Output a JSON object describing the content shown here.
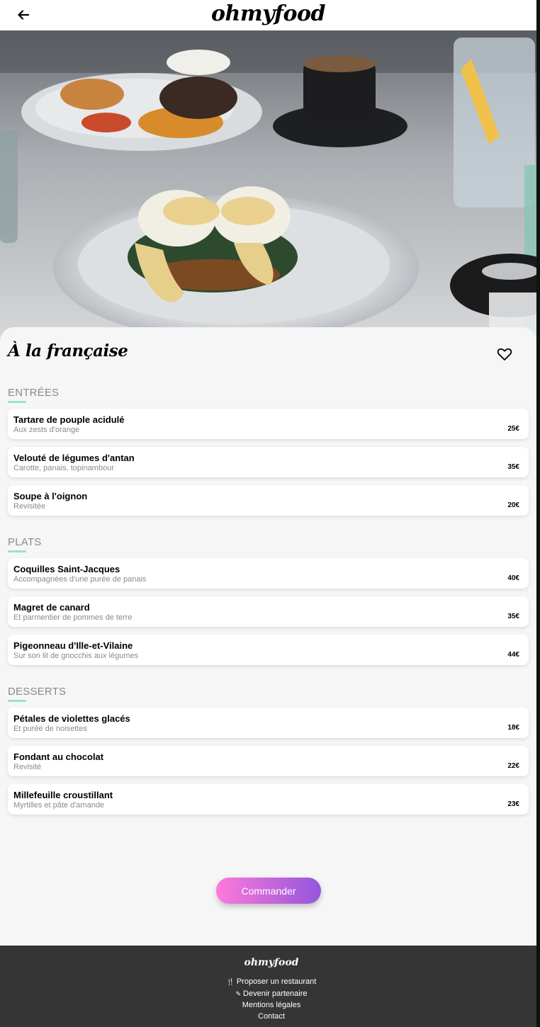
{
  "header": {
    "logo": "ohmyfood",
    "back_icon": "arrow-left-icon"
  },
  "restaurant": {
    "title": "À la française",
    "favorite_icon": "heart-outline-icon"
  },
  "menu": [
    {
      "section": "ENTRÉES",
      "dishes": [
        {
          "name": "Tartare de pouple acidulé",
          "desc": "Aux zests d'orange",
          "price": "25€"
        },
        {
          "name": "Velouté de légumes d'antan",
          "desc": "Carotte, panais, topinambour",
          "price": "35€"
        },
        {
          "name": "Soupe à l'oignon",
          "desc": "Revisitée",
          "price": "20€"
        }
      ]
    },
    {
      "section": "PLATS",
      "dishes": [
        {
          "name": "Coquilles Saint-Jacques",
          "desc": "Accompagnées d'une purée de panais",
          "price": "40€"
        },
        {
          "name": "Magret de canard",
          "desc": "Et parmentier de pommes de terre",
          "price": "35€"
        },
        {
          "name": "Pigeonneau d'Ille-et-Vilaine",
          "desc": "Sur son lit de gnocchis aux légumes",
          "price": "44€"
        }
      ]
    },
    {
      "section": "DESSERTS",
      "dishes": [
        {
          "name": "Pétales de violettes glacés",
          "desc": "Et purée de noisettes",
          "price": "18€"
        },
        {
          "name": "Fondant au chocolat",
          "desc": "Revisité",
          "price": "22€"
        },
        {
          "name": "Millefeuille croustillant",
          "desc": "Myrtilles et pâte d'amande",
          "price": "23€"
        }
      ]
    }
  ],
  "order_button": "Commander",
  "footer": {
    "logo": "ohmyfood",
    "links": [
      {
        "label": "Proposer un restaurant",
        "icon": "utensils-icon"
      },
      {
        "label": "Devenir partenaire",
        "icon": "handshake-icon"
      },
      {
        "label": "Mentions légales",
        "icon": ""
      },
      {
        "label": "Contact",
        "icon": ""
      }
    ]
  },
  "colors": {
    "accent_underline": "#99e2d0",
    "button_start": "#ff79da",
    "button_end": "#9356dc",
    "footer_bg": "#353535"
  }
}
